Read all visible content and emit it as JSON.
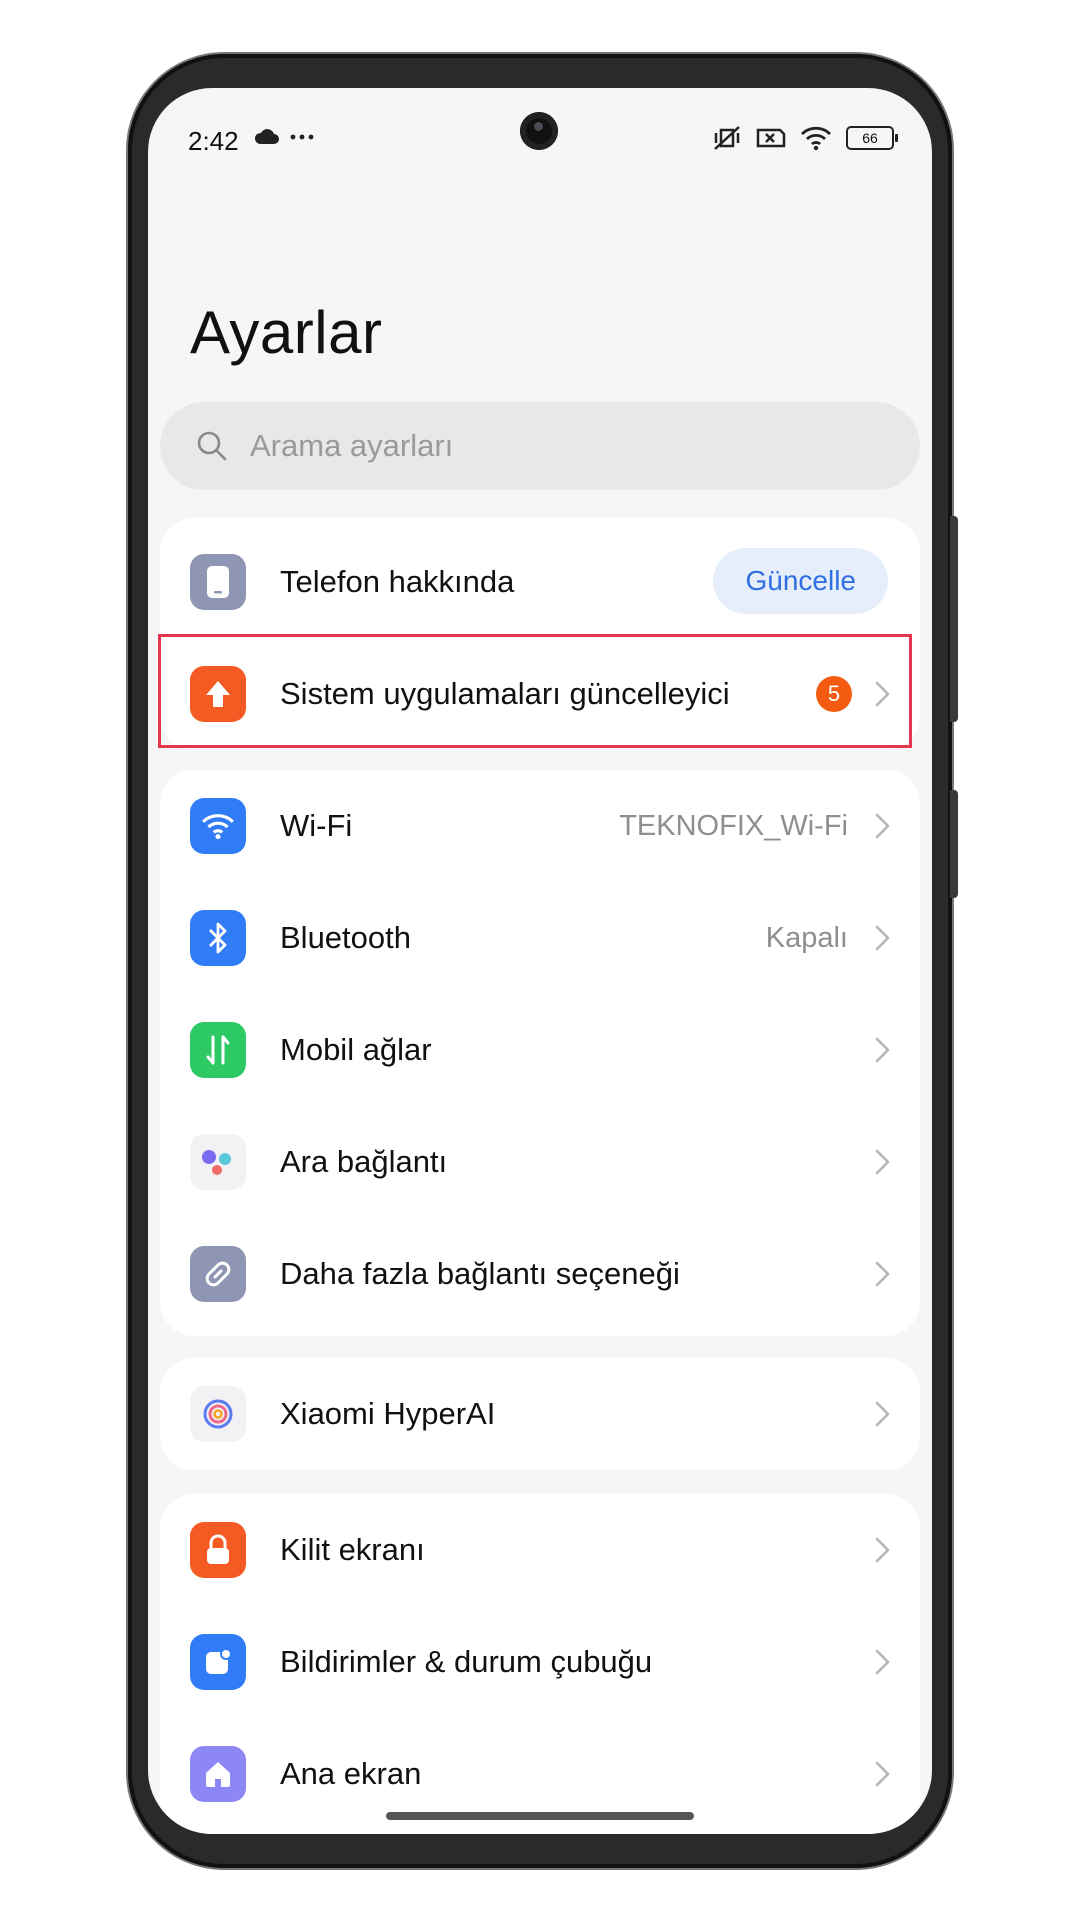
{
  "status_bar": {
    "time": "2:42",
    "left_icons": [
      "cloud-icon",
      "more-dots-icon"
    ],
    "right_icons": [
      "vibrate-off-icon",
      "sim-none-icon",
      "wifi-icon"
    ],
    "battery": "66"
  },
  "header": {
    "title": "Ayarlar"
  },
  "search": {
    "placeholder": "Arama ayarları"
  },
  "groups": [
    {
      "items": [
        {
          "label": "Telefon hakkında",
          "icon": "phone-icon",
          "icon_color": "#8e96b4",
          "action_pill": "Güncelle"
        },
        {
          "label": "Sistem uygulamaları güncelleyici",
          "icon": "upload-arrow-icon",
          "icon_color": "#f45a22",
          "badge": "5",
          "highlighted": true
        }
      ]
    },
    {
      "items": [
        {
          "label": "Wi-Fi",
          "icon": "wifi-icon",
          "icon_color": "#2f7cf6",
          "value": "TEKNOFIX_Wi-Fi"
        },
        {
          "label": "Bluetooth",
          "icon": "bluetooth-icon",
          "icon_color": "#2f7cf6",
          "value": "Kapalı"
        },
        {
          "label": "Mobil ağlar",
          "icon": "mobile-data-icon",
          "icon_color": "#2dc965"
        },
        {
          "label": "Ara bağlantı",
          "icon": "interconnect-icon",
          "icon_color": "#f2f2f4"
        },
        {
          "label": "Daha fazla bağlantı seçeneği",
          "icon": "link-icon",
          "icon_color": "#8e96b4"
        }
      ]
    },
    {
      "items": [
        {
          "label": "Xiaomi HyperAI",
          "icon": "hyperai-icon",
          "icon_color": "#f2f2f4"
        }
      ]
    },
    {
      "items": [
        {
          "label": "Kilit ekranı",
          "icon": "lock-icon",
          "icon_color": "#f45a22"
        },
        {
          "label": "Bildirimler & durum çubuğu",
          "icon": "notification-icon",
          "icon_color": "#2f7cf6"
        },
        {
          "label": "Ana ekran",
          "icon": "home-icon",
          "icon_color": "#8d86f5"
        }
      ]
    }
  ]
}
